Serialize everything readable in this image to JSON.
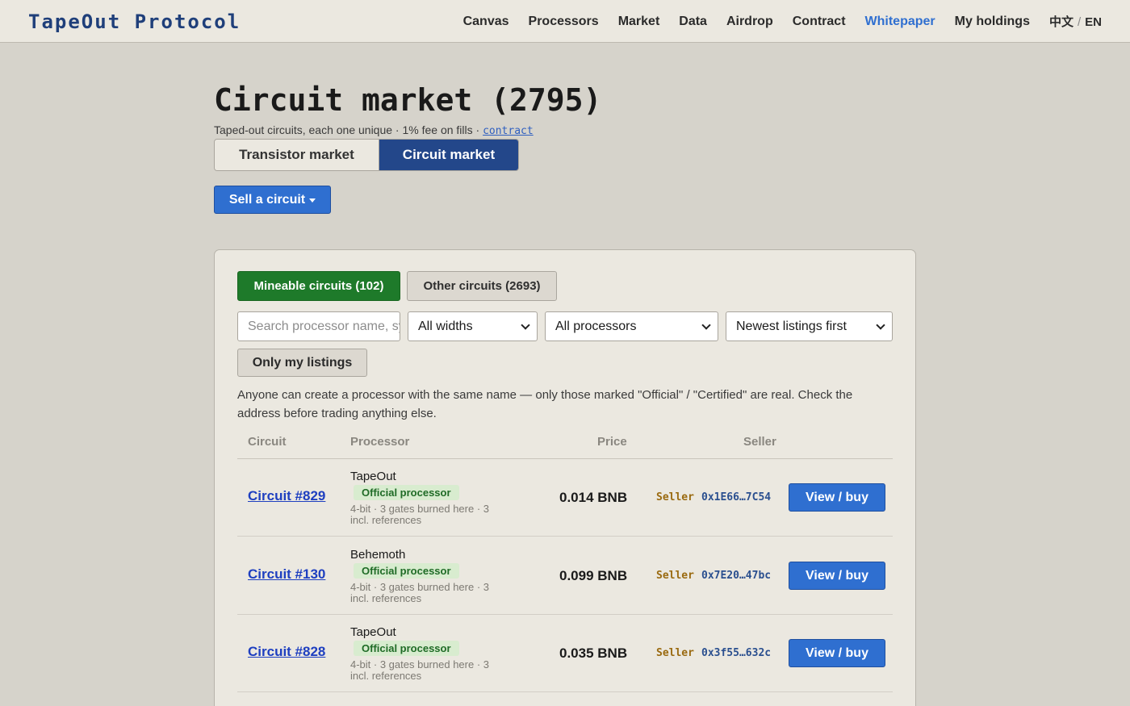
{
  "app": {
    "logo": "TapeOut Protocol",
    "nav": [
      "Canvas",
      "Processors",
      "Market",
      "Data",
      "Airdrop",
      "Contract",
      "Whitepaper",
      "My holdings"
    ],
    "active_nav": "Whitepaper",
    "lang": {
      "zh": "中文",
      "sep": "/",
      "en": "EN"
    }
  },
  "page": {
    "title": "Circuit market (2795)",
    "subtitle": "Taped-out circuits, each one unique · 1% fee on fills ·",
    "contract_link": "contract"
  },
  "market_switch": {
    "transistor": "Transistor market",
    "circuit": "Circuit market",
    "active": "circuit"
  },
  "sell_button": "Sell a circuit",
  "filters": {
    "tabs": [
      {
        "label": "Mineable circuits (102)",
        "active": true
      },
      {
        "label": "Other circuits (2693)",
        "active": false
      }
    ],
    "search_placeholder": "Search processor name, symbol",
    "width_select": "All widths",
    "processor_select": "All processors",
    "sort_select": "Newest listings first",
    "only_mine": "Only my listings"
  },
  "notice": "Anyone can create a processor with the same name — only those marked \"Official\" / \"Certified\" are real. Check the address before trading anything else.",
  "table": {
    "headers": {
      "circuit": "Circuit",
      "processor": "Processor",
      "price": "Price",
      "seller": "Seller"
    },
    "rows": [
      {
        "circuit": "Circuit #829",
        "processor": "TapeOut",
        "badge": "Official processor",
        "meta": "4-bit · 3 gates burned here · 3 incl. references",
        "price": "0.014 BNB",
        "seller_label": "Seller",
        "seller_addr": "0x1E66…7C54",
        "action": "View / buy"
      },
      {
        "circuit": "Circuit #130",
        "processor": "Behemoth",
        "badge": "Official processor",
        "meta": "4-bit · 3 gates burned here · 3 incl. references",
        "price": "0.099 BNB",
        "seller_label": "Seller",
        "seller_addr": "0x7E20…47bc",
        "action": "View / buy"
      },
      {
        "circuit": "Circuit #828",
        "processor": "TapeOut",
        "badge": "Official processor",
        "meta": "4-bit · 3 gates burned here · 3 incl. references",
        "price": "0.035 BNB",
        "seller_label": "Seller",
        "seller_addr": "0x3f55…632c",
        "action": "View / buy"
      }
    ]
  },
  "colors": {
    "accent": "#2f6fd0",
    "navy": "#23478a",
    "green": "#1e7a2a",
    "background": "#d6d3cb"
  }
}
